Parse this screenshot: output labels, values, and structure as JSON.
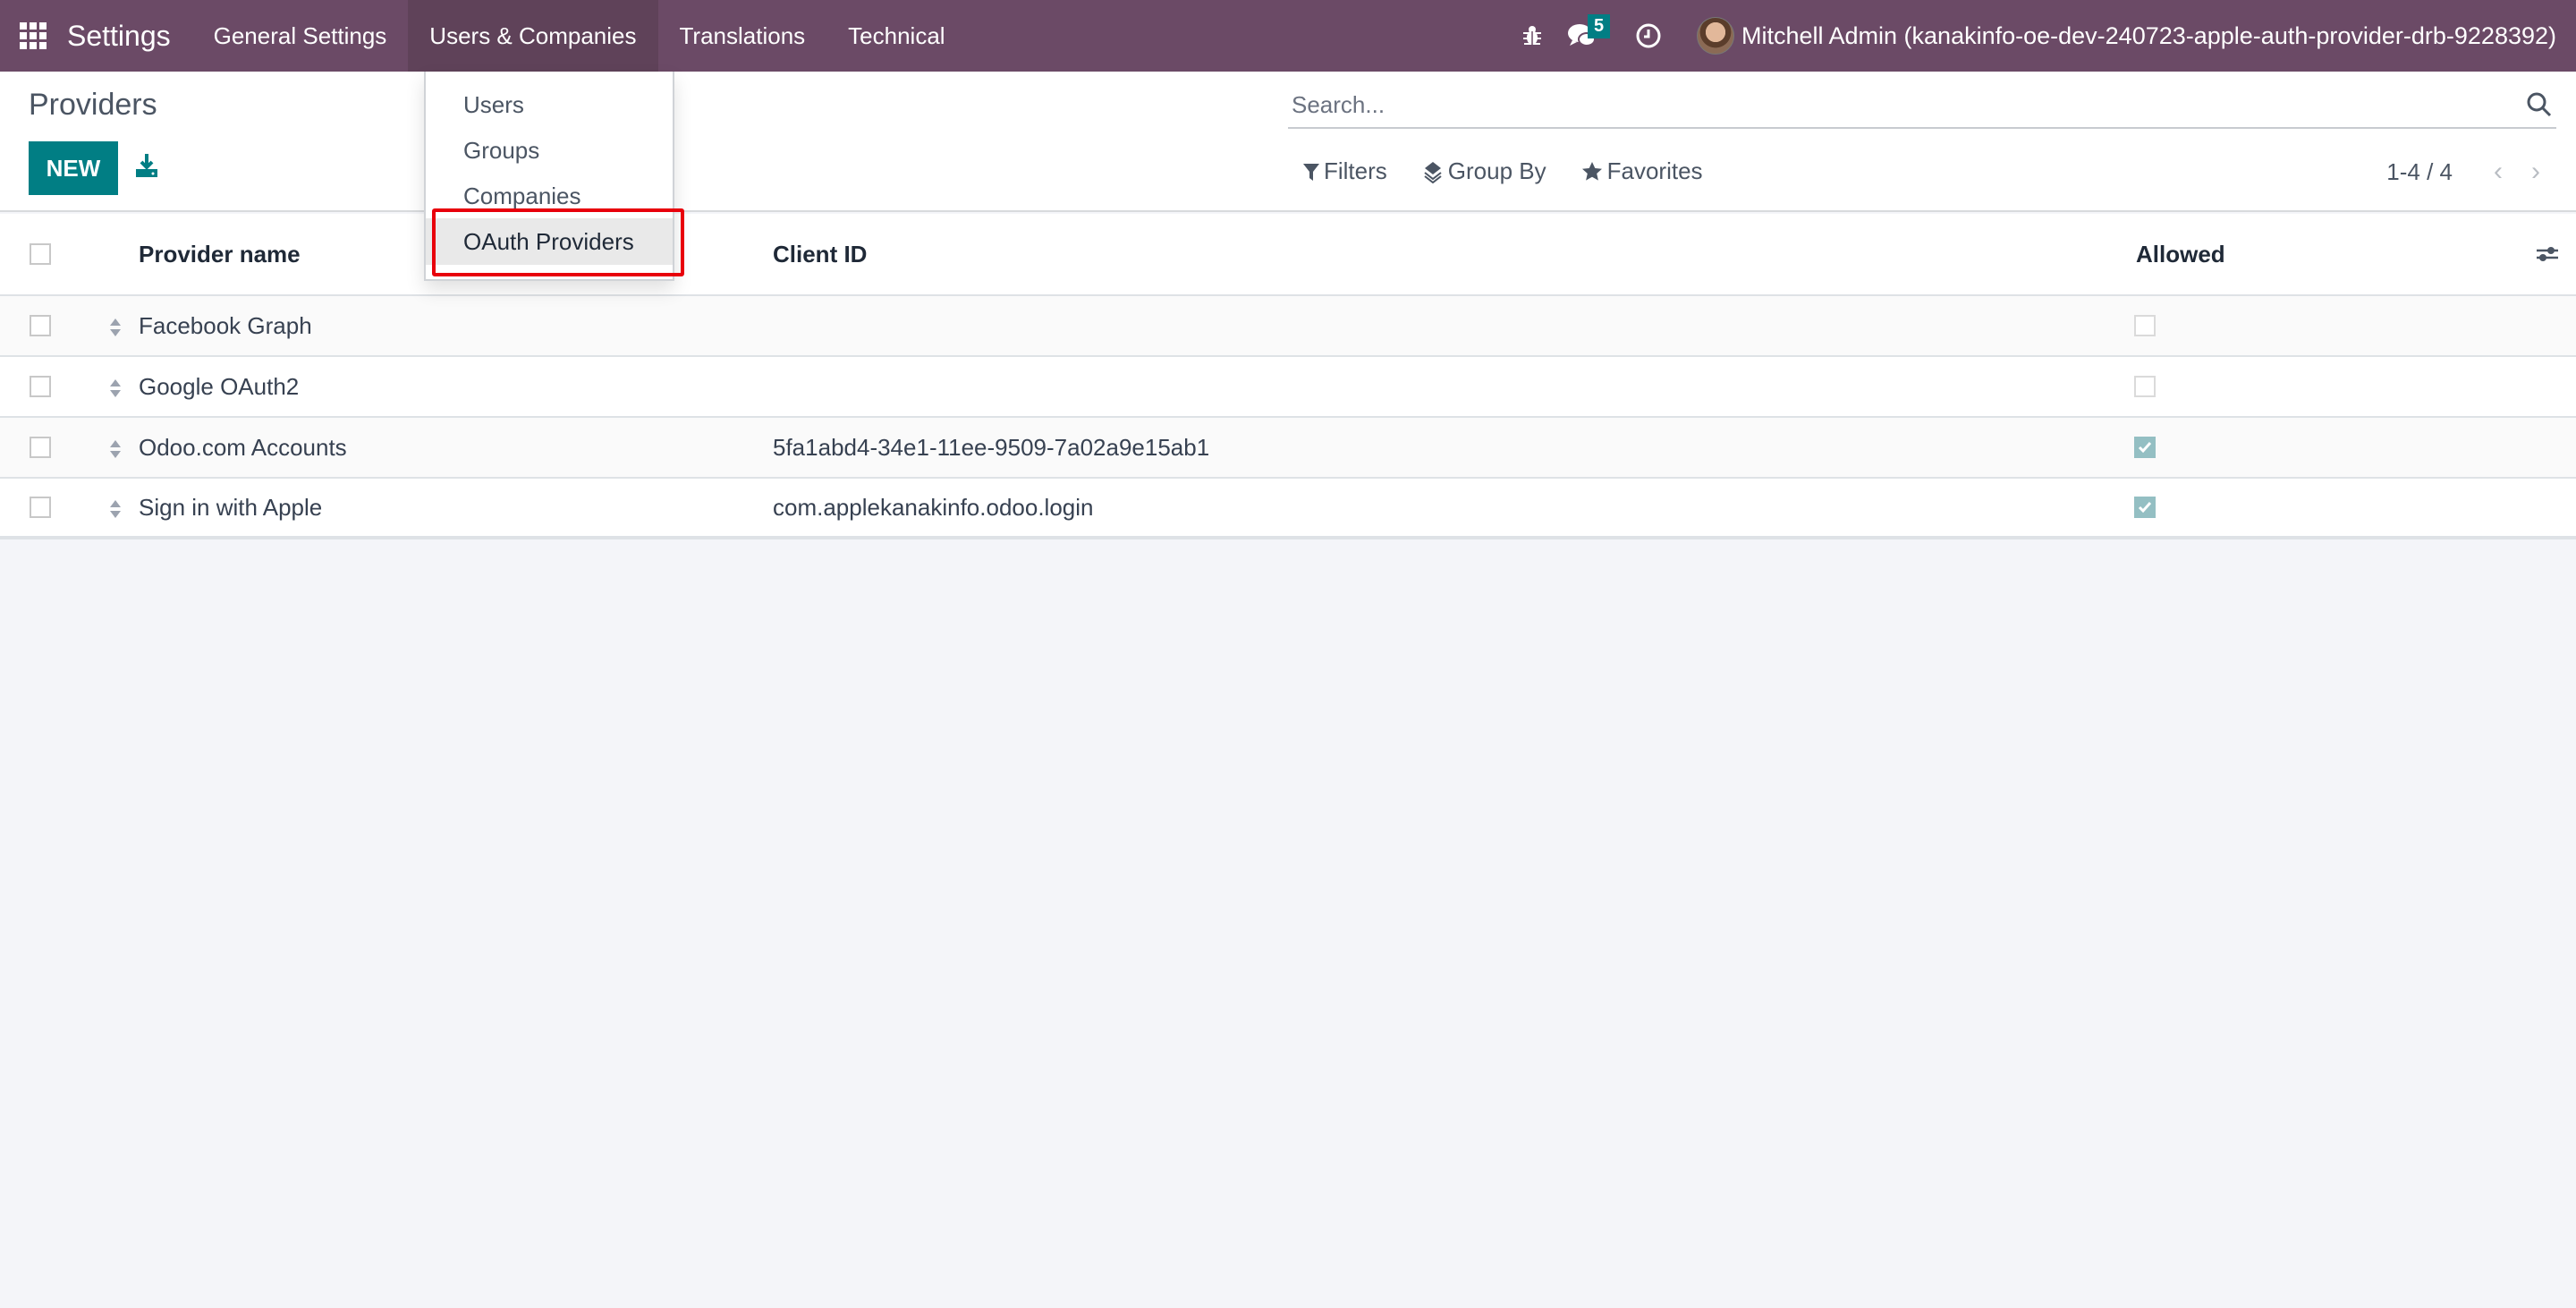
{
  "navbar": {
    "app_name": "Settings",
    "menus": [
      "General Settings",
      "Users & Companies",
      "Translations",
      "Technical"
    ],
    "open_menu": "Users & Companies",
    "messages_badge": "5",
    "user_label": "Mitchell Admin (kanakinfo-oe-dev-240723-apple-auth-provider-drb-9228392)",
    "icons": [
      "apps-grid-icon",
      "bug-icon",
      "chat-icon",
      "clock-icon"
    ]
  },
  "dropdown": {
    "items": [
      "Users",
      "Groups",
      "Companies",
      "OAuth Providers"
    ],
    "highlighted": "OAuth Providers"
  },
  "control_panel": {
    "title": "Providers",
    "new_label": "NEW",
    "search_placeholder": "Search...",
    "filters_label": "Filters",
    "groupby_label": "Group By",
    "favorites_label": "Favorites",
    "pager": "1-4 / 4"
  },
  "table": {
    "columns": [
      "Provider name",
      "Client ID",
      "Allowed"
    ],
    "rows": [
      {
        "name": "Facebook Graph",
        "client_id": "",
        "allowed": false
      },
      {
        "name": "Google OAuth2",
        "client_id": "",
        "allowed": false
      },
      {
        "name": "Odoo.com Accounts",
        "client_id": "5fa1abd4-34e1-11ee-9509-7a02a9e15ab1",
        "allowed": true
      },
      {
        "name": "Sign in with Apple",
        "client_id": "com.applekanakinfo.odoo.login",
        "allowed": true
      }
    ]
  },
  "colors": {
    "navbar": "#6b4a66",
    "primary": "#017e84",
    "checked": "#94bfc3",
    "highlight": "#e8000b"
  }
}
